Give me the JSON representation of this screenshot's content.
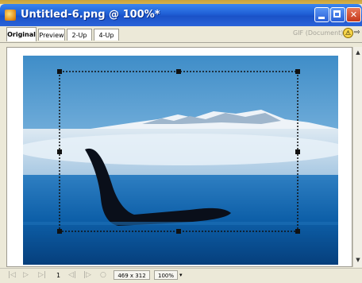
{
  "window": {
    "title": "Untitled-6.png @ 100%*",
    "minimize_glyph": "",
    "close_glyph": "✕"
  },
  "tabs": [
    {
      "label": "Original",
      "active": true
    },
    {
      "label": "Preview",
      "active": false
    },
    {
      "label": "2-Up",
      "active": false
    },
    {
      "label": "4-Up",
      "active": false
    }
  ],
  "format_text": "GIF (Document)",
  "warning_glyph": "⚠",
  "arrow_glyph": "⇨",
  "status": {
    "first": "|◁",
    "play": "▷",
    "last": "▷|",
    "frame": "1",
    "prev": "◁|",
    "next": "|▷",
    "loop": "○",
    "dimensions": "469 x 312",
    "zoom": "100%",
    "zoom_arrow": "▾"
  },
  "scroll": {
    "up": "▲",
    "down": "▼"
  },
  "colors": {
    "titlebar": "#1f5fd6",
    "chrome": "#ece9d8",
    "sky": "#5a9fd4",
    "sea": "#0b5aa0"
  },
  "icons": [
    "app-icon",
    "minimize-icon",
    "maximize-icon",
    "close-icon",
    "warning-icon",
    "export-arrow-icon"
  ]
}
